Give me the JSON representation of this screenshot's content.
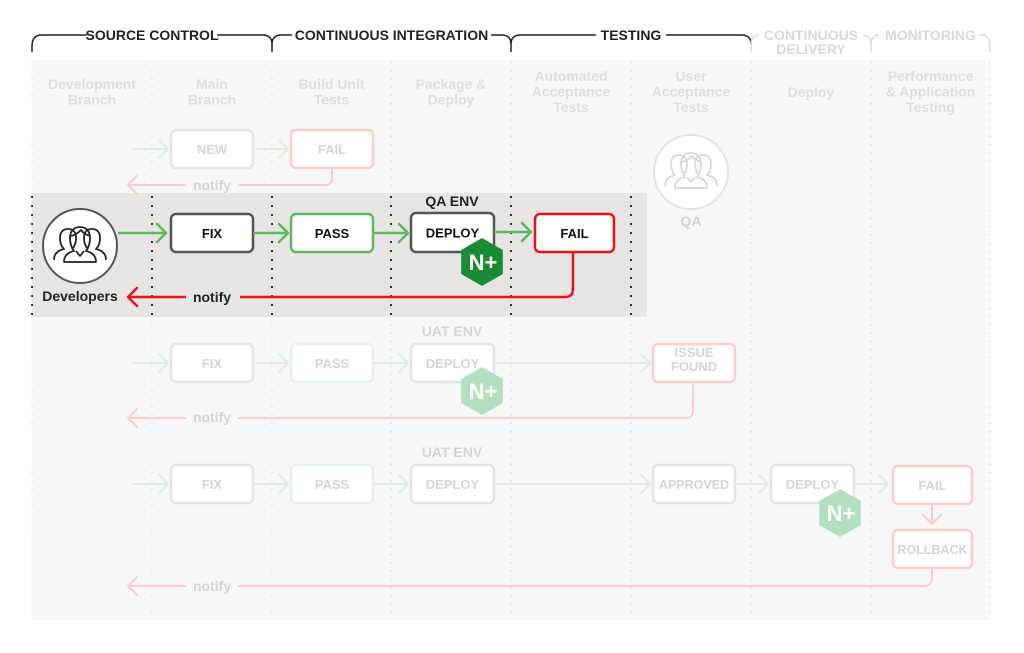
{
  "colors": {
    "active_text": "#222222",
    "active_box": "#555555",
    "green": "#5cb85c",
    "red": "#ee1111",
    "nginx_green": "#1a8a34",
    "faded_text": "#d4d4d4",
    "faded_box": "#e4e4e4",
    "faded_green": "#dcf0dc",
    "faded_red": "#fbcccc",
    "faded_nginx": "#b3dfbe",
    "lane_bg": "#f8f8f8",
    "highlight_bg": "#e7e6e4"
  },
  "phases": [
    {
      "label": "SOURCE CONTROL",
      "active": true
    },
    {
      "label": "CONTINUOUS INTEGRATION",
      "active": true
    },
    {
      "label": "TESTING",
      "active": true
    },
    {
      "label": "CONTINUOUS DELIVERY",
      "label_lines": [
        "CONTINUOUS",
        "DELIVERY"
      ],
      "active": false
    },
    {
      "label": "MONITORING",
      "active": false
    }
  ],
  "columns": [
    {
      "lines": [
        "Development",
        "Branch"
      ]
    },
    {
      "lines": [
        "Main",
        "Branch"
      ]
    },
    {
      "lines": [
        "Build Unit",
        "Tests"
      ]
    },
    {
      "lines": [
        "Package &",
        "Deploy"
      ]
    },
    {
      "lines": [
        "Automated",
        "Acceptance",
        "Tests"
      ]
    },
    {
      "lines": [
        "User",
        "Acceptance",
        "Tests"
      ]
    },
    {
      "lines": [
        "Deploy"
      ]
    },
    {
      "lines": [
        "Performance",
        "& Application",
        "Testing"
      ]
    }
  ],
  "actors": {
    "developers": {
      "label": "Developers",
      "icon": "people-group-icon"
    },
    "qa": {
      "label": "QA",
      "icon": "people-group-icon"
    }
  },
  "rows": [
    {
      "id": "row-1",
      "active": false,
      "boxes": [
        {
          "label": "NEW",
          "style": "gray"
        },
        {
          "label": "FAIL",
          "style": "red"
        }
      ],
      "notify_label": "notify"
    },
    {
      "id": "row-2",
      "active": true,
      "env_label": "QA ENV",
      "boxes": [
        {
          "label": "FIX",
          "style": "gray"
        },
        {
          "label": "PASS",
          "style": "green"
        },
        {
          "label": "DEPLOY",
          "style": "gray",
          "badge": "N+"
        },
        {
          "label": "FAIL",
          "style": "red"
        }
      ],
      "notify_label": "notify"
    },
    {
      "id": "row-3",
      "active": false,
      "env_label": "UAT ENV",
      "boxes": [
        {
          "label": "FIX",
          "style": "gray"
        },
        {
          "label": "PASS",
          "style": "green"
        },
        {
          "label": "DEPLOY",
          "style": "gray",
          "badge": "N+"
        },
        {
          "label": "ISSUE FOUND",
          "lines": [
            "ISSUE",
            "FOUND"
          ],
          "style": "red"
        }
      ],
      "notify_label": "notify"
    },
    {
      "id": "row-4",
      "active": false,
      "env_label": "UAT ENV",
      "boxes": [
        {
          "label": "FIX",
          "style": "gray"
        },
        {
          "label": "PASS",
          "style": "green"
        },
        {
          "label": "DEPLOY",
          "style": "gray"
        },
        {
          "label": "APPROVED",
          "style": "gray"
        },
        {
          "label": "DEPLOY",
          "style": "gray",
          "badge": "N+"
        },
        {
          "label": "FAIL",
          "style": "red"
        },
        {
          "label": "ROLLBACK",
          "style": "red"
        }
      ],
      "notify_label": "notify"
    }
  ]
}
